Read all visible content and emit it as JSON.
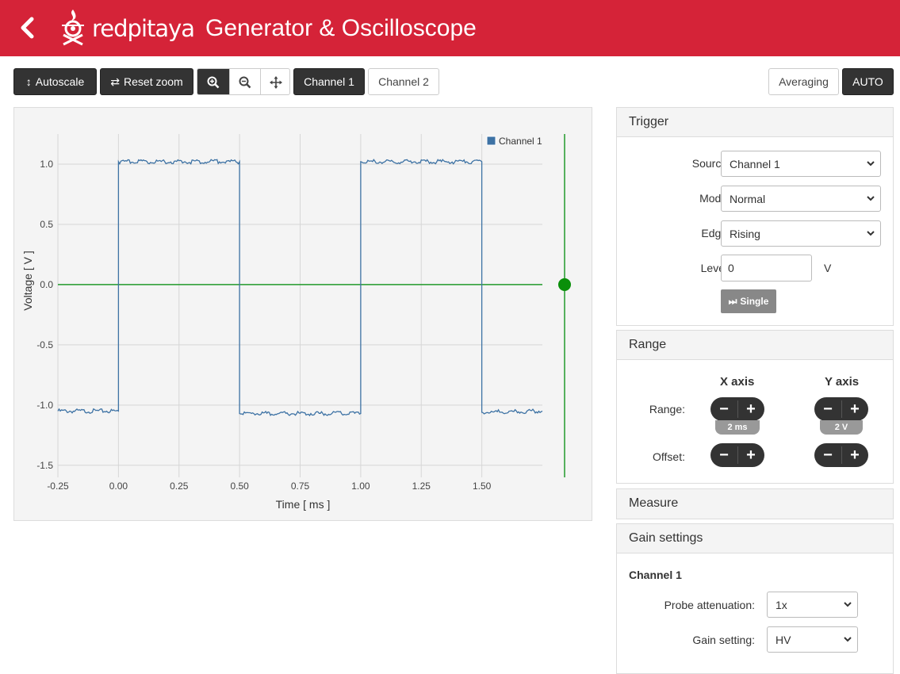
{
  "header": {
    "logo_text": "redpitaya",
    "title": "Generator & Oscilloscope"
  },
  "toolbar": {
    "autoscale_label": "Autoscale",
    "reset_zoom_label": "Reset zoom",
    "channel1_label": "Channel 1",
    "channel2_label": "Channel 2",
    "averaging_label": "Averaging",
    "auto_label": "AUTO"
  },
  "trigger": {
    "title": "Trigger",
    "source_label": "Source:",
    "source_value": "Channel 1",
    "mode_label": "Mode:",
    "mode_value": "Normal",
    "edge_label": "Edge:",
    "edge_value": "Rising",
    "level_label": "Level:",
    "level_value": "0",
    "level_unit": "V",
    "single_label": "Single"
  },
  "range": {
    "title": "Range",
    "x_axis_label": "X axis",
    "y_axis_label": "Y axis",
    "range_label": "Range:",
    "offset_label": "Offset:",
    "x_range_value": "2 ms",
    "y_range_value": "2 V",
    "minus": "−",
    "plus": "+"
  },
  "measure": {
    "title": "Measure"
  },
  "gain": {
    "title": "Gain settings",
    "channel_label": "Channel 1",
    "probe_label": "Probe attenuation:",
    "probe_value": "1x",
    "gain_label": "Gain setting:",
    "gain_value": "HV"
  },
  "chart_data": {
    "type": "line",
    "xlabel": "Time [ ms ]",
    "ylabel": "Voltage [ V ]",
    "xlim": [
      -0.25,
      1.75
    ],
    "ylim": [
      -1.6,
      1.25
    ],
    "x_ticks": [
      -0.25,
      0.0,
      0.25,
      0.5,
      0.75,
      1.0,
      1.25,
      1.5
    ],
    "x_tick_labels": [
      "-0.25",
      "0.00",
      "0.25",
      "0.50",
      "0.75",
      "1.00",
      "1.25",
      "1.50"
    ],
    "y_ticks": [
      1.0,
      0.5,
      0.0,
      -0.5,
      -1.0,
      -1.5
    ],
    "y_tick_labels": [
      "1.0",
      "0.5",
      "0.0",
      "-0.5",
      "-1.0",
      "-1.5"
    ],
    "legend_position": "top-right",
    "grid": true,
    "series": [
      {
        "name": "Channel 1",
        "color": "#3d72a4",
        "x": [
          -0.25,
          0.0,
          0.0,
          0.5,
          0.5,
          1.0,
          1.0,
          1.5,
          1.5,
          1.75
        ],
        "values": [
          -1.05,
          -1.05,
          1.02,
          1.02,
          -1.07,
          -1.07,
          1.02,
          1.02,
          -1.06,
          -1.05
        ]
      }
    ],
    "trigger_level": 0.0,
    "trigger_color": "#229a2b"
  }
}
